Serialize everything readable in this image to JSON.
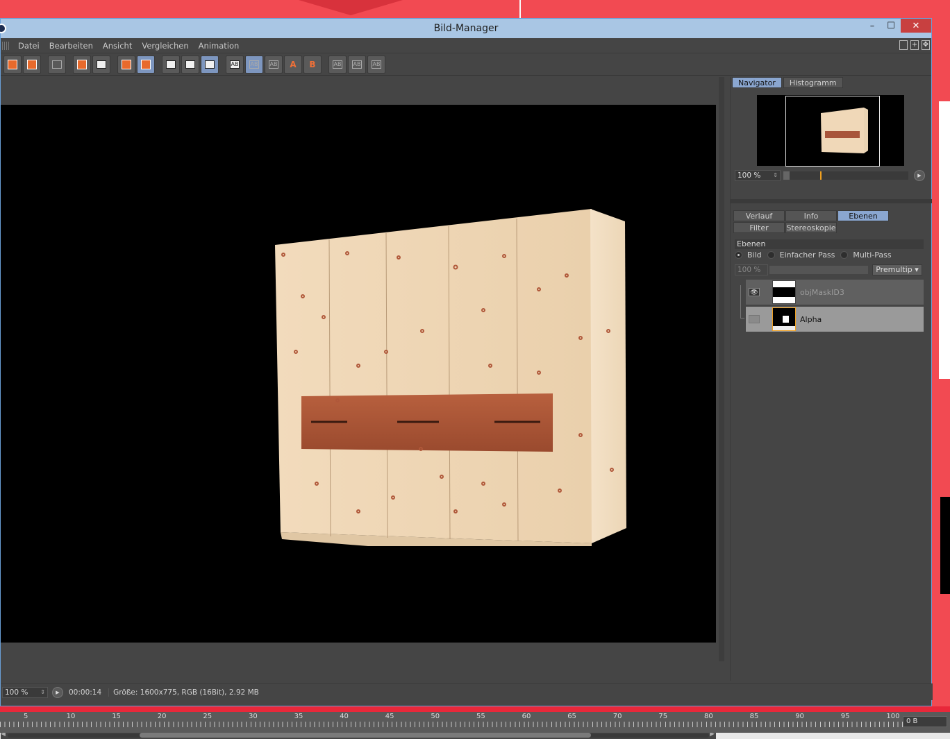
{
  "window": {
    "title": "Bild-Manager",
    "min_glyph": "–",
    "max_glyph": "☐",
    "close_glyph": "✕"
  },
  "menu": [
    "Datei",
    "Bearbeiten",
    "Ansicht",
    "Vergleichen",
    "Animation"
  ],
  "toolbar": {
    "ab_label": "AB",
    "a_label": "A",
    "b_label": "B"
  },
  "viewport": {
    "image_subject": "wardrobe-render"
  },
  "status": {
    "zoom": "100 %",
    "time": "00:00:14",
    "info": "Größe: 1600x775, RGB (16Bit), 2.92 MB"
  },
  "navigator": {
    "tabs": [
      "Navigator",
      "Histogramm"
    ],
    "active_tab": "Navigator",
    "zoom": "100 %",
    "slider_fraction": 0.25
  },
  "layers_panel": {
    "tabs": [
      "Verlauf",
      "Info",
      "Ebenen",
      "Filter",
      "Stereoskopie"
    ],
    "active_tab": "Ebenen",
    "section_title": "Ebenen",
    "mode_options": [
      "Bild",
      "Einfacher Pass",
      "Multi-Pass"
    ],
    "selected_mode": "Bild",
    "opacity": "100 %",
    "blend_mode": "Premultip",
    "layers": [
      {
        "name": "objMaskID3",
        "visible": true
      },
      {
        "name": "Alpha",
        "visible": false,
        "selected": true
      }
    ]
  },
  "timeline": {
    "labels": [
      "5",
      "10",
      "15",
      "20",
      "25",
      "30",
      "35",
      "40",
      "45",
      "50",
      "55",
      "60",
      "65",
      "70",
      "75",
      "80",
      "85",
      "90",
      "95",
      "100"
    ],
    "size_field": "0 B"
  },
  "colors": {
    "accent_tab": "#8aa6d0",
    "titlebar": "#a9c6e4",
    "close": "#c84040",
    "panel_bg": "#454545"
  }
}
